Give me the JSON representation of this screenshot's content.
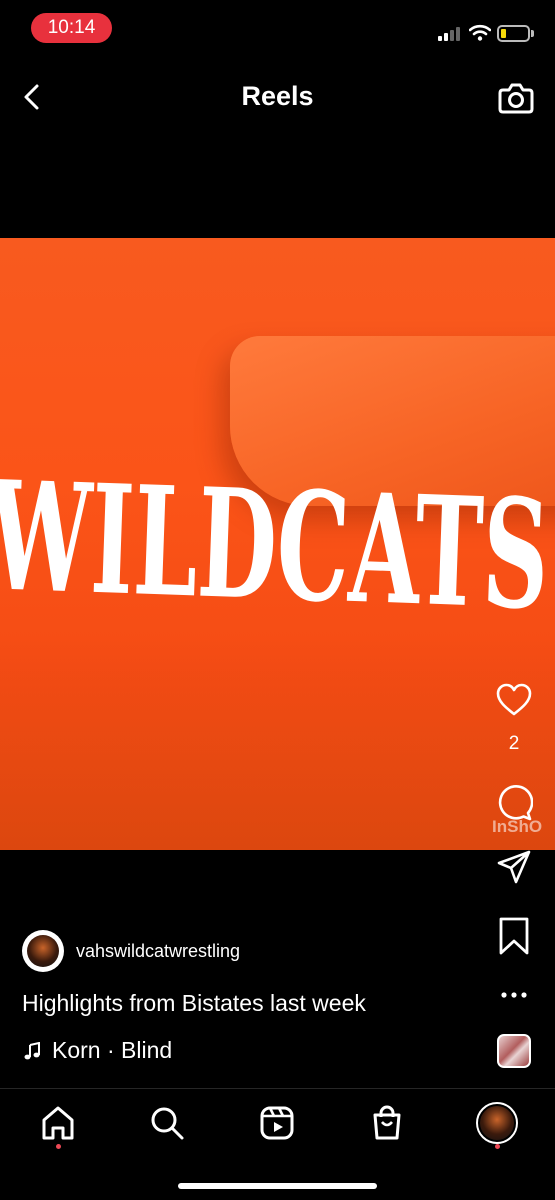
{
  "status_bar": {
    "time": "10:14",
    "time_pill_color": "#e8313d",
    "icons": [
      "cellular-signal-icon",
      "wifi-icon",
      "battery-icon"
    ]
  },
  "header": {
    "title": "Reels",
    "left_icon": "back-chevron-icon",
    "right_icon": "camera-icon"
  },
  "video": {
    "shirt_text": "WILDCATS",
    "watermark": "InShO",
    "background_color": "#f85a1f"
  },
  "actions": {
    "like_count": "2",
    "icons": [
      "heart-icon",
      "comment-icon",
      "share-icon",
      "bookmark-icon",
      "more-icon"
    ]
  },
  "post": {
    "username": "vahswildcatwrestling",
    "caption": "Highlights from Bistates last week",
    "audio": "Korn · Blind"
  },
  "bottom_nav": {
    "items": [
      "home-icon",
      "search-icon",
      "reels-icon",
      "shop-icon",
      "profile-icon"
    ],
    "notification_dot_color": "#ed4956"
  }
}
